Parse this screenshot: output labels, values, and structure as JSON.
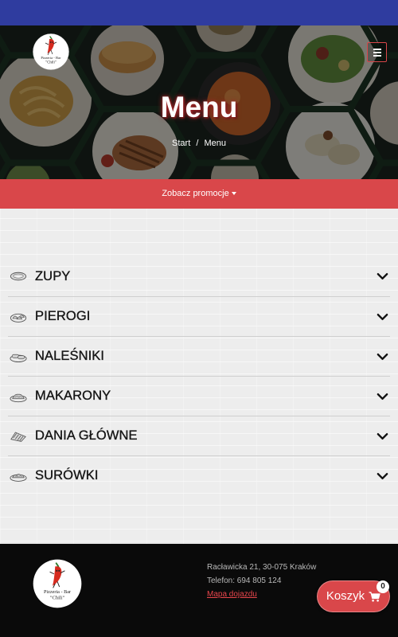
{
  "colors": {
    "top_bar": "#2f3c9f",
    "accent": "#d9474a",
    "footer_bg": "#0a0a0a",
    "link": "#e8454b"
  },
  "brand": {
    "line1": "Pizzeria - Bar",
    "line2": "\"Chili\""
  },
  "header": {
    "menu_button_icon": "hamburger-icon"
  },
  "hero": {
    "title": "Menu",
    "breadcrumb": {
      "home": "Start",
      "separator": "/",
      "current": "Menu"
    }
  },
  "promo_bar": {
    "label": "Zobacz promocje",
    "icon": "caret-down-icon"
  },
  "categories": [
    {
      "label": "ZUPY",
      "icon": "soup-icon"
    },
    {
      "label": "PIEROGI",
      "icon": "dumplings-icon"
    },
    {
      "label": "NALEŚNIKI",
      "icon": "pancakes-icon"
    },
    {
      "label": "MAKARONY",
      "icon": "pasta-icon"
    },
    {
      "label": "DANIA GŁÓWNE",
      "icon": "main-dish-icon"
    },
    {
      "label": "SURÓWKI",
      "icon": "salad-icon"
    }
  ],
  "category_toggle_icon": "chevron-down-icon",
  "footer": {
    "address": "Racławicka 21, 30-075 Kraków",
    "phone": "Telefon: 694 805 124",
    "map_link": "Mapa dojazdu"
  },
  "cart": {
    "label": "Koszyk",
    "icon": "cart-icon",
    "count": "0"
  }
}
